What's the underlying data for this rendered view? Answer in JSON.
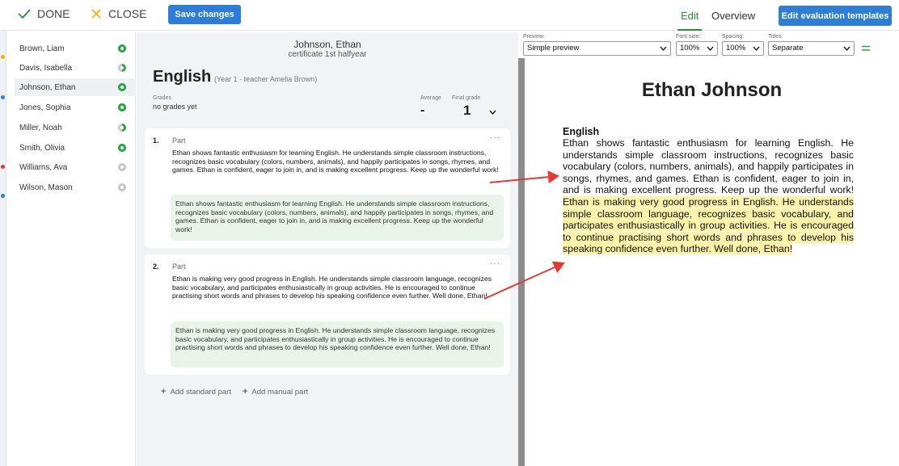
{
  "toolbar": {
    "done_label": "DONE",
    "close_label": "CLOSE",
    "save_label": "Save changes",
    "tab_edit": "Edit",
    "tab_overview": "Overview",
    "templates_label": "Edit evaluation templates"
  },
  "students": [
    {
      "name": "Brown, Liam",
      "status": "done"
    },
    {
      "name": "Davis, Isabella",
      "status": "partial"
    },
    {
      "name": "Johnson, Ethan",
      "status": "done",
      "active": true
    },
    {
      "name": "Jones, Sophia",
      "status": "done"
    },
    {
      "name": "Miller, Noah",
      "status": "partial"
    },
    {
      "name": "Smith, Olivia",
      "status": "done"
    },
    {
      "name": "Williams, Ava",
      "status": "empty"
    },
    {
      "name": "Wilson, Mason",
      "status": "empty"
    }
  ],
  "editor": {
    "student_name": "Johnson, Ethan",
    "certificate": "certificate 1st halfyear",
    "subject": "English",
    "subject_meta": "(Year 1 · teacher Amelia Brown)",
    "grades_label": "Grades",
    "grades_value": "no grades yet",
    "average_label": "Average",
    "average_value": "-",
    "final_label": "Final grade",
    "final_value": "1",
    "parts": [
      {
        "number": "1.",
        "label": "Part",
        "text": "Ethan shows fantastic enthusiasm for learning English. He understands simple classroom instructions, recognizes basic vocabulary (colors, numbers, animals), and happily participates in songs, rhymes, and games. Ethan is confident, eager to join in, and is making excellent progress. Keep up the wonderful work!",
        "preview": "Ethan shows fantastic enthusiasm for learning English. He understands simple classroom instructions, recognizes basic vocabulary (colors, numbers, animals), and happily participates in songs, rhymes, and games. Ethan is confident, eager to join in, and is making excellent progress. Keep up the wonderful work!"
      },
      {
        "number": "2.",
        "label": "Part",
        "text": "Ethan is making very good progress in English. He understands simple classroom language, recognizes basic vocabulary, and participates enthusiastically in group activities. He is encouraged to continue practising short words and phrases to develop his speaking confidence even further. Well done, Ethan!",
        "preview": "Ethan is making very good progress in English. He understands simple classroom language, recognizes basic vocabulary, and participates enthusiastically in group activities. He is encouraged to continue practising short words and phrases to develop his speaking confidence even further. Well done, Ethan!"
      }
    ],
    "add_standard": "Add standard part",
    "add_manual": "Add manual part",
    "more_glyph": "···"
  },
  "preview": {
    "preview_label": "Preview:",
    "preview_value": "Simple preview",
    "font_size_label": "Font size:",
    "font_size_value": "100%",
    "spacing_label": "Spacing:",
    "spacing_value": "100%",
    "titles_label": "Titles:",
    "titles_value": "Separate",
    "page_title": "Ethan Johnson",
    "page_subject": "English",
    "body_part1": "Ethan shows fantastic enthusiasm for learning English. He understands simple classroom instructions, recognizes basic vocabulary (colors, numbers, animals), and happily participates in songs, rhymes, and games. Ethan is confident, eager to join in, and is making excellent progress. Keep up the wonderful work! ",
    "body_part2": "Ethan is making very good progress in English. He understands simple classroom language, recognizes basic vocabulary, and participates enthusiastically in group activities. He is encouraged to continue practising short words and phrases to develop his speaking confidence even further. Well done, Ethan!"
  },
  "colors": {
    "accent_blue": "#2d7ed8",
    "active_green": "#2a8a3e",
    "status_green": "#27a844",
    "highlight": "#fbf4a8",
    "arrow_red": "#e53935"
  }
}
